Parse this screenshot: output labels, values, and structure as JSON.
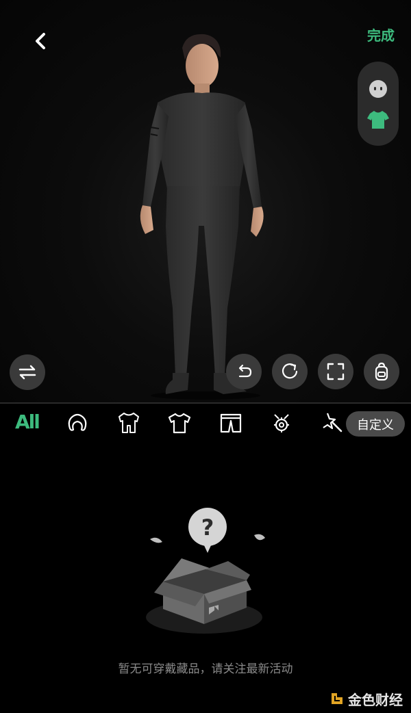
{
  "header": {
    "done_label": "完成"
  },
  "tabs": {
    "all_label": "All",
    "custom_label": "自定义"
  },
  "empty_state": {
    "message": "暂无可穿戴藏品，请关注最新活动"
  },
  "watermark": {
    "text": "金色财经"
  },
  "colors": {
    "accent": "#3dbb7e",
    "background": "#000000",
    "button_bg": "#3a3a3a",
    "pill_bg": "#4a4a4a",
    "muted_text": "#8a8a8a"
  },
  "icons": {
    "back": "chevron-left-icon",
    "face": "face-icon",
    "shirt": "shirt-icon",
    "swap": "swap-arrows-icon",
    "undo": "undo-icon",
    "redo": "redo-icon",
    "fullscreen": "fullscreen-icon",
    "backpack": "backpack-icon",
    "tab_hair": "hair-icon",
    "tab_suit": "outfit-icon",
    "tab_tshirt": "tshirt-icon",
    "tab_pants": "pants-icon",
    "tab_accessory": "accessory-icon",
    "tab_effect": "effect-icon"
  }
}
